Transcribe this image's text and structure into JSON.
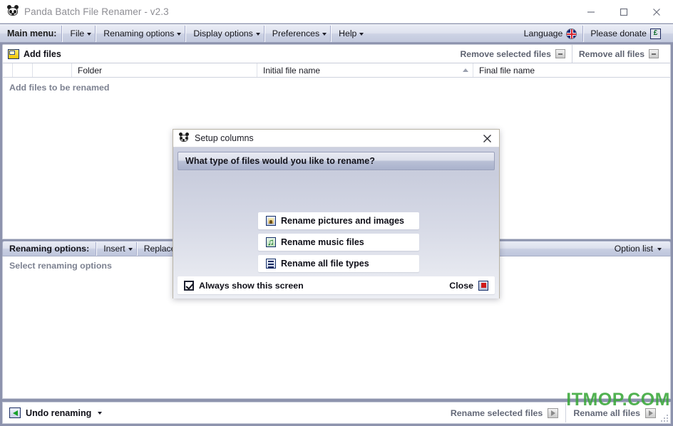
{
  "window": {
    "title": "Panda Batch File Renamer - v2.3",
    "app_icon": "panda-icon",
    "controls": {
      "minimize": "minimize-icon",
      "maximize": "maximize-icon",
      "close": "close-icon"
    }
  },
  "menubar": {
    "label": "Main menu:",
    "items": [
      {
        "label": "File"
      },
      {
        "label": "Renaming options"
      },
      {
        "label": "Display options"
      },
      {
        "label": "Preferences"
      },
      {
        "label": "Help"
      }
    ],
    "right": [
      {
        "label": "Language",
        "icon": "uk-flag-icon"
      },
      {
        "label": "Please donate",
        "icon": "pound-currency-icon"
      }
    ]
  },
  "toolbar": {
    "add_files_label": "Add files",
    "add_files_icon": "folder-icon",
    "remove_selected_label": "Remove selected files",
    "remove_all_label": "Remove all files",
    "remove_icon": "minus-icon"
  },
  "filelist": {
    "columns": [
      "",
      "",
      "",
      "Folder",
      "Initial file name",
      "Final file name"
    ],
    "sort_indicator": "ascending",
    "empty_text": "Add files to be renamed"
  },
  "renaming_options": {
    "label": "Renaming options:",
    "items": [
      {
        "label": "Insert"
      },
      {
        "label": "Replace"
      }
    ],
    "option_list_label": "Option list",
    "empty_text": "Select renaming options"
  },
  "bottombar": {
    "undo_label": "Undo renaming",
    "undo_icon": "undo-arrow-icon",
    "rename_selected_label": "Rename selected files",
    "rename_all_label": "Rename all files",
    "run_icon": "play-icon"
  },
  "watermark": {
    "text": "ITMOP.COM",
    "color": "#3aa83a"
  },
  "dialog": {
    "title": "Setup columns",
    "title_icon": "panda-icon",
    "close_icon": "close-x-icon",
    "question": "What type of files would you like to rename?",
    "choices": [
      {
        "label": "Rename pictures and images",
        "icon": "picture-icon"
      },
      {
        "label": "Rename music files",
        "icon": "music-note-icon"
      },
      {
        "label": "Rename all file types",
        "icon": "file-list-icon"
      }
    ],
    "always_show_label": "Always show this screen",
    "always_show_checked": true,
    "close_label": "Close",
    "close_button_icon": "red-square-icon"
  }
}
